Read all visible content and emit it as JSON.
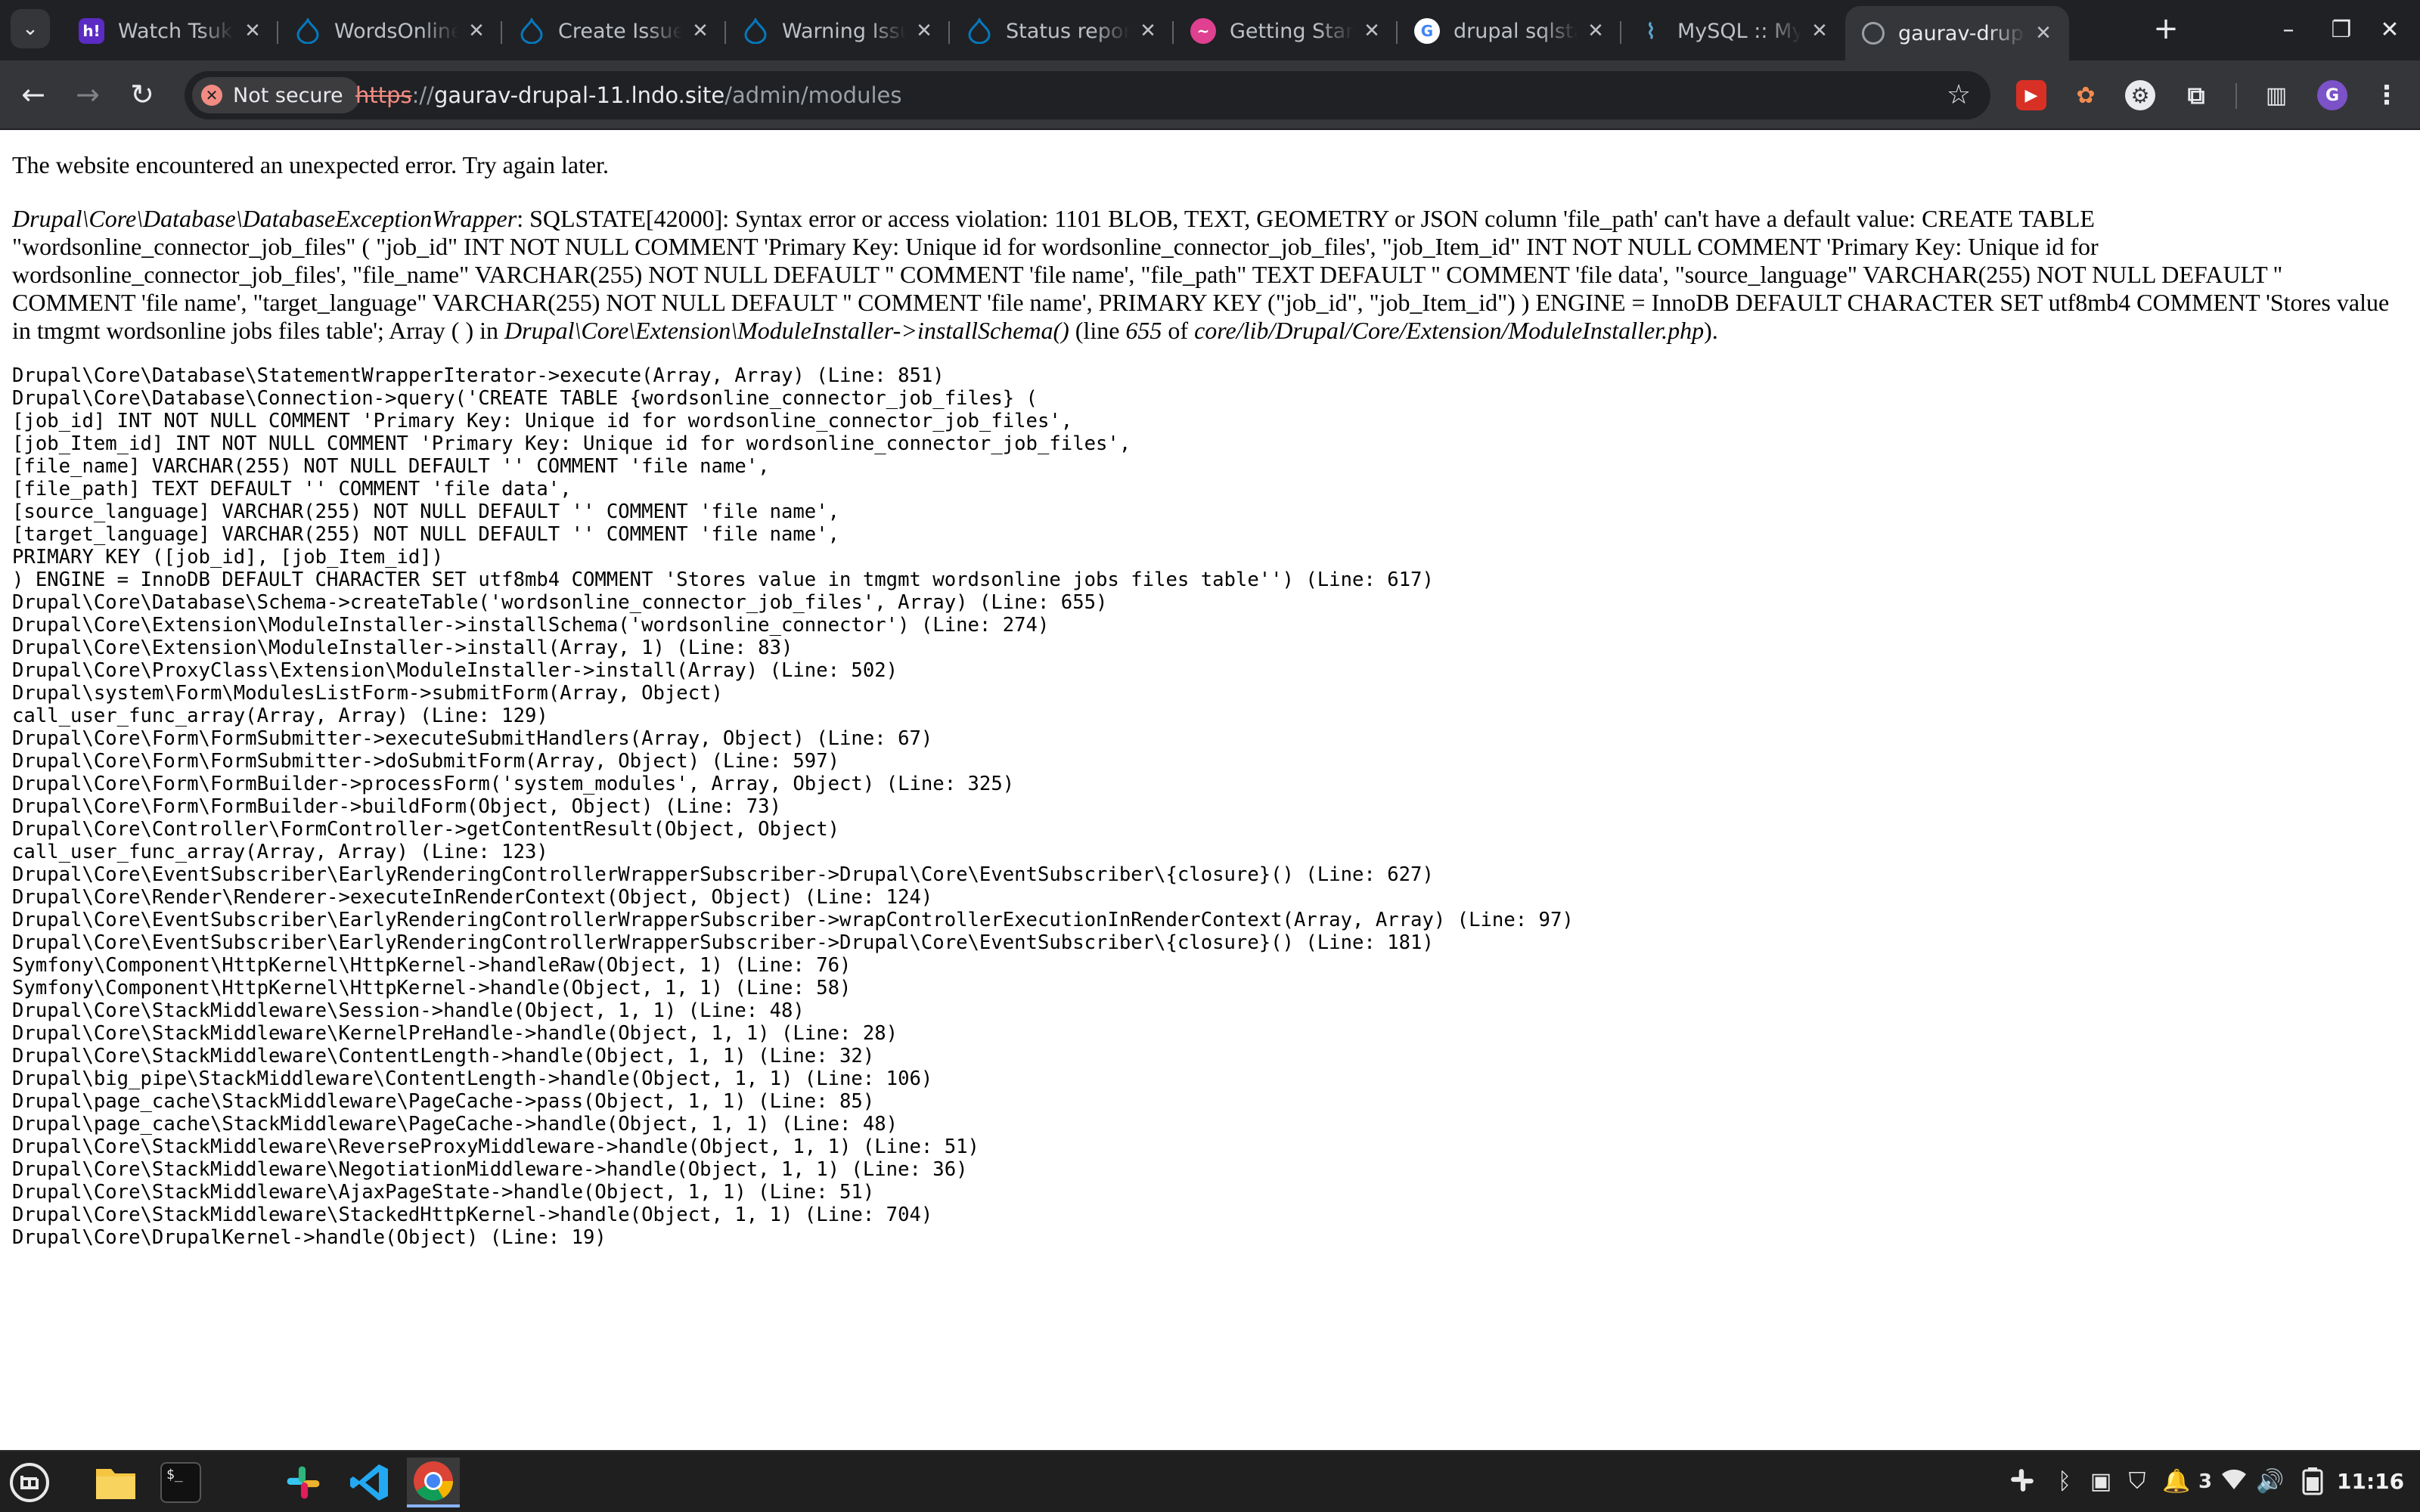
{
  "tabs": [
    {
      "title": "Watch Tsukin",
      "favicon": "h!",
      "color": "#5b2bc4"
    },
    {
      "title": "WordsOnline",
      "favicon": "drupal",
      "color": "#0678be"
    },
    {
      "title": "Create Issue",
      "favicon": "drupal",
      "color": "#0678be"
    },
    {
      "title": "Warning Issu",
      "favicon": "drupal",
      "color": "#0678be"
    },
    {
      "title": "Status report",
      "favicon": "drupal",
      "color": "#0678be"
    },
    {
      "title": "Getting Start",
      "favicon": "lando",
      "color": "#df4090"
    },
    {
      "title": "drupal sqlsta",
      "favicon": "G",
      "color": "#4285f4"
    },
    {
      "title": "MySQL :: MyS",
      "favicon": "mysql",
      "color": "#00758f"
    },
    {
      "title": "gaurav-drupa",
      "favicon": "globe",
      "color": "#9aa0a6",
      "active": true
    }
  ],
  "toolbar": {
    "security_label": "Not secure",
    "url_scheme": "https",
    "url_sep": "://",
    "url_host": "gaurav-drupal-11.lndo.site",
    "url_path": "/admin/modules",
    "profile_initial": "G"
  },
  "page": {
    "message": "The website encountered an unexpected error. Try again later.",
    "error_class": "Drupal\\Core\\Database\\DatabaseExceptionWrapper",
    "error_text": ": SQLSTATE[42000]: Syntax error or access violation: 1101 BLOB, TEXT, GEOMETRY or JSON column 'file_path' can't have a default value: CREATE TABLE \"wordsonline_connector_job_files\" ( \"job_id\" INT NOT NULL COMMENT 'Primary Key: Unique id for wordsonline_connector_job_files', \"job_Item_id\" INT NOT NULL COMMENT 'Primary Key: Unique id for wordsonline_connector_job_files', \"file_name\" VARCHAR(255) NOT NULL DEFAULT '' COMMENT 'file name', \"file_path\" TEXT DEFAULT '' COMMENT 'file data', \"source_language\" VARCHAR(255) NOT NULL DEFAULT '' COMMENT 'file name', \"target_language\" VARCHAR(255) NOT NULL DEFAULT '' COMMENT 'file name', PRIMARY KEY (\"job_id\", \"job_Item_id\") ) ENGINE = InnoDB DEFAULT CHARACTER SET utf8mb4 COMMENT 'Stores value in tmgmt wordsonline jobs files table'; Array ( ) in ",
    "error_method": "Drupal\\Core\\Extension\\ModuleInstaller->installSchema()",
    "error_line_prefix": " (line ",
    "error_line": "655",
    "error_of": " of ",
    "error_file": "core/lib/Drupal/Core/Extension/ModuleInstaller.php",
    "error_end": ").",
    "trace": [
      "Drupal\\Core\\Database\\StatementWrapperIterator->execute(Array, Array) (Line: 851)",
      "Drupal\\Core\\Database\\Connection->query('CREATE TABLE {wordsonline_connector_job_files} (",
      "[job_id] INT NOT NULL COMMENT 'Primary Key: Unique id for wordsonline_connector_job_files',",
      "[job_Item_id] INT NOT NULL COMMENT 'Primary Key: Unique id for wordsonline_connector_job_files',",
      "[file_name] VARCHAR(255) NOT NULL DEFAULT '' COMMENT 'file name',",
      "[file_path] TEXT DEFAULT '' COMMENT 'file data',",
      "[source_language] VARCHAR(255) NOT NULL DEFAULT '' COMMENT 'file name',",
      "[target_language] VARCHAR(255) NOT NULL DEFAULT '' COMMENT 'file name',",
      "PRIMARY KEY ([job_id], [job_Item_id])",
      ") ENGINE = InnoDB DEFAULT CHARACTER SET utf8mb4 COMMENT 'Stores value in tmgmt wordsonline jobs files table'') (Line: 617)",
      "Drupal\\Core\\Database\\Schema->createTable('wordsonline_connector_job_files', Array) (Line: 655)",
      "Drupal\\Core\\Extension\\ModuleInstaller->installSchema('wordsonline_connector') (Line: 274)",
      "Drupal\\Core\\Extension\\ModuleInstaller->install(Array, 1) (Line: 83)",
      "Drupal\\Core\\ProxyClass\\Extension\\ModuleInstaller->install(Array) (Line: 502)",
      "Drupal\\system\\Form\\ModulesListForm->submitForm(Array, Object)",
      "call_user_func_array(Array, Array) (Line: 129)",
      "Drupal\\Core\\Form\\FormSubmitter->executeSubmitHandlers(Array, Object) (Line: 67)",
      "Drupal\\Core\\Form\\FormSubmitter->doSubmitForm(Array, Object) (Line: 597)",
      "Drupal\\Core\\Form\\FormBuilder->processForm('system_modules', Array, Object) (Line: 325)",
      "Drupal\\Core\\Form\\FormBuilder->buildForm(Object, Object) (Line: 73)",
      "Drupal\\Core\\Controller\\FormController->getContentResult(Object, Object)",
      "call_user_func_array(Array, Array) (Line: 123)",
      "Drupal\\Core\\EventSubscriber\\EarlyRenderingControllerWrapperSubscriber->Drupal\\Core\\EventSubscriber\\{closure}() (Line: 627)",
      "Drupal\\Core\\Render\\Renderer->executeInRenderContext(Object, Object) (Line: 124)",
      "Drupal\\Core\\EventSubscriber\\EarlyRenderingControllerWrapperSubscriber->wrapControllerExecutionInRenderContext(Array, Array) (Line: 97)",
      "Drupal\\Core\\EventSubscriber\\EarlyRenderingControllerWrapperSubscriber->Drupal\\Core\\EventSubscriber\\{closure}() (Line: 181)",
      "Symfony\\Component\\HttpKernel\\HttpKernel->handleRaw(Object, 1) (Line: 76)",
      "Symfony\\Component\\HttpKernel\\HttpKernel->handle(Object, 1, 1) (Line: 58)",
      "Drupal\\Core\\StackMiddleware\\Session->handle(Object, 1, 1) (Line: 48)",
      "Drupal\\Core\\StackMiddleware\\KernelPreHandle->handle(Object, 1, 1) (Line: 28)",
      "Drupal\\Core\\StackMiddleware\\ContentLength->handle(Object, 1, 1) (Line: 32)",
      "Drupal\\big_pipe\\StackMiddleware\\ContentLength->handle(Object, 1, 1) (Line: 106)",
      "Drupal\\page_cache\\StackMiddleware\\PageCache->pass(Object, 1, 1) (Line: 85)",
      "Drupal\\page_cache\\StackMiddleware\\PageCache->handle(Object, 1, 1) (Line: 48)",
      "Drupal\\Core\\StackMiddleware\\ReverseProxyMiddleware->handle(Object, 1, 1) (Line: 51)",
      "Drupal\\Core\\StackMiddleware\\NegotiationMiddleware->handle(Object, 1, 1) (Line: 36)",
      "Drupal\\Core\\StackMiddleware\\AjaxPageState->handle(Object, 1, 1) (Line: 51)",
      "Drupal\\Core\\StackMiddleware\\StackedHttpKernel->handle(Object, 1, 1) (Line: 704)",
      "Drupal\\Core\\DrupalKernel->handle(Object) (Line: 19)"
    ]
  },
  "taskbar": {
    "notification_count": "3",
    "clock": "11:16"
  }
}
